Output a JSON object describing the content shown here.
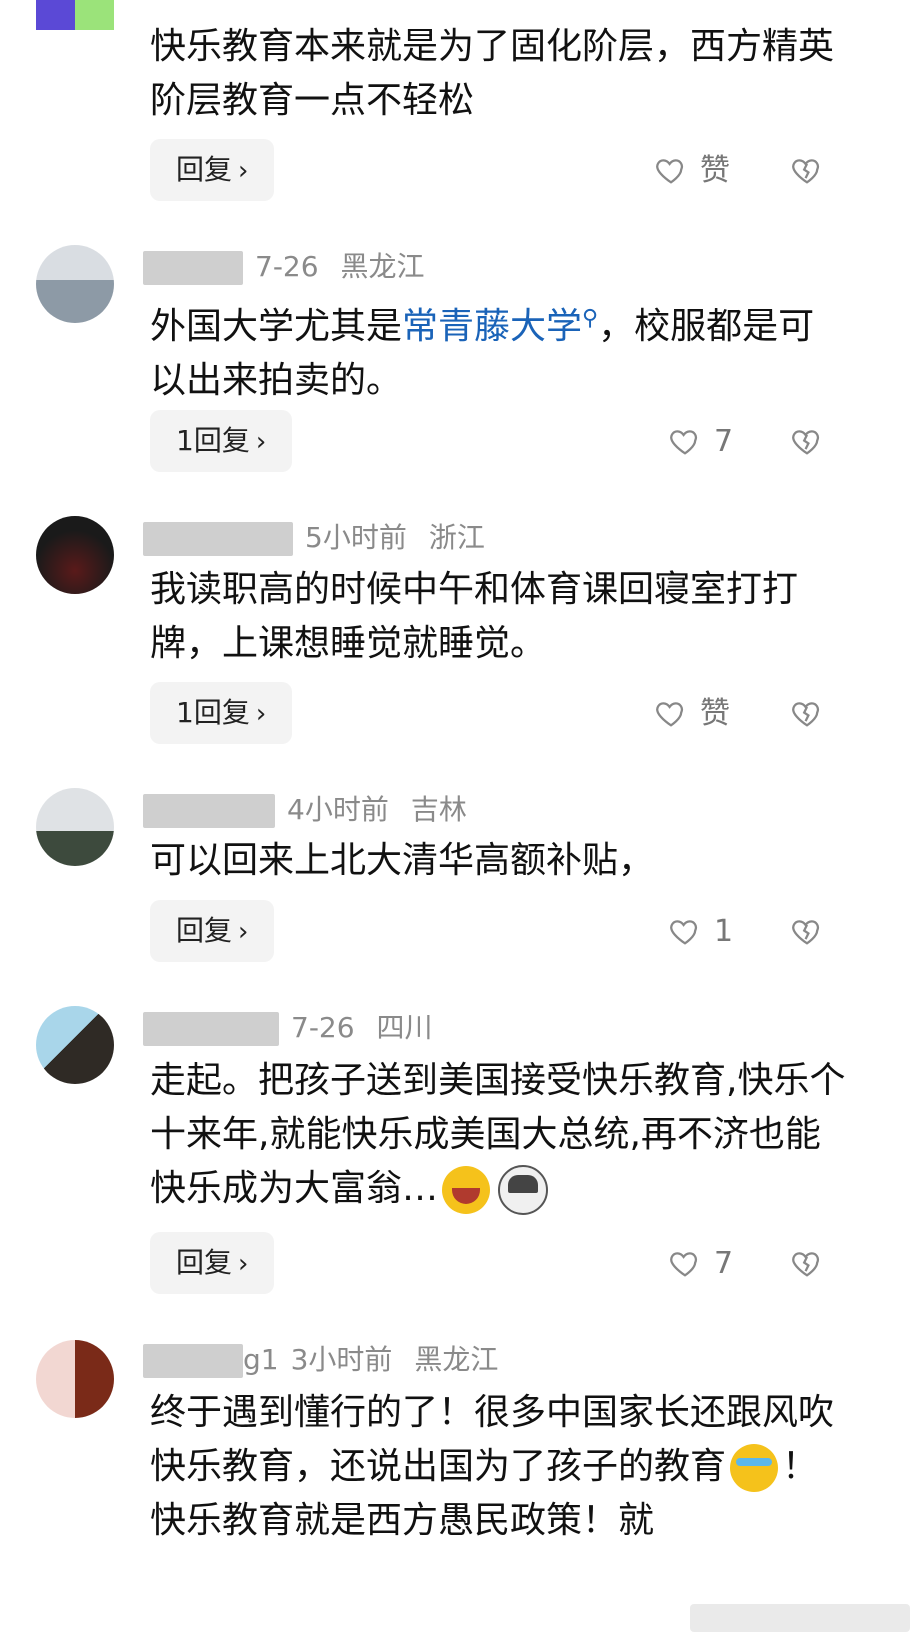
{
  "comments": [
    {
      "id": "c1",
      "user": "",
      "time": "",
      "location": "",
      "text": "快乐教育本来就是为了固化阶层，西方精英阶层教育一点不轻松",
      "reply_label": "回复",
      "like_label": "赞"
    },
    {
      "id": "c2",
      "user": "",
      "time": "7-26",
      "location": "黑龙江",
      "text_before": "外国大学尤其是",
      "link_text": "常青藤大学",
      "text_after": "，校服都是可以出来拍卖的。",
      "reply_label": "1回复",
      "like_label": "7"
    },
    {
      "id": "c3",
      "user": "",
      "time": "5小时前",
      "location": "浙江",
      "text": "我读职高的时候中午和体育课回寝室打打牌，上课想睡觉就睡觉。",
      "reply_label": "1回复",
      "like_label": "赞"
    },
    {
      "id": "c4",
      "user": "",
      "time": "4小时前",
      "location": "吉林",
      "text": "可以回来上北大清华高额补贴，",
      "reply_label": "回复",
      "like_label": "1"
    },
    {
      "id": "c5",
      "user": "",
      "time": "7-26",
      "location": "四川",
      "text": "走起。把孩子送到美国接受快乐教育,快乐个十来年,就能快乐成美国大总统,再不济也能快乐成为大富翁…",
      "reply_label": "回复",
      "like_label": "7"
    },
    {
      "id": "c6",
      "user": "g1",
      "time": "3小时前",
      "location": "黑龙江",
      "text_before": "终于遇到懂行的了！很多中国家长还跟风吹快乐教育，还说出国为了孩子的教育",
      "text_after": "！快乐教育就是西方愚民政策！就"
    }
  ],
  "icons": {
    "like": "heart-outline-icon",
    "dislike": "broken-heart-icon",
    "reply_chevron": "chevron-right-icon",
    "search_mark": "search-icon",
    "emoji_laugh": "laughing-face-emoji-icon",
    "emoji_dog": "dog-face-emoji-icon",
    "emoji_cry": "crying-face-emoji-icon"
  },
  "colors": {
    "link": "#1a63b8",
    "meta_text": "#8a8a8a",
    "reply_bg": "#f3f3f3"
  }
}
